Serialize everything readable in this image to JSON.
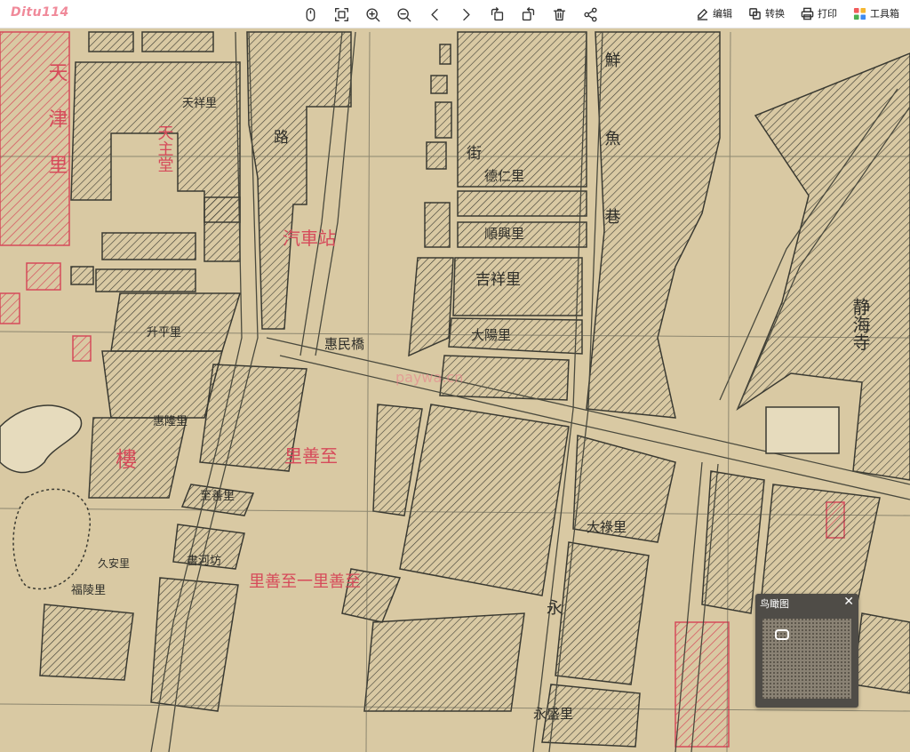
{
  "app": {
    "logo": "Ditu114"
  },
  "toolbar": {
    "tools": [
      {
        "name": "mouse-icon"
      },
      {
        "name": "fit-screen-icon"
      },
      {
        "name": "zoom-in-icon"
      },
      {
        "name": "zoom-out-icon"
      },
      {
        "name": "chevron-left-icon"
      },
      {
        "name": "chevron-right-icon"
      },
      {
        "name": "rotate-left-icon"
      },
      {
        "name": "rotate-right-icon"
      },
      {
        "name": "trash-icon"
      },
      {
        "name": "share-icon"
      }
    ],
    "edit_label": "编辑",
    "convert_label": "转换",
    "print_label": "打印",
    "toolbox_label": "工具箱"
  },
  "map": {
    "watermark": "paywa.cn",
    "labels": {
      "tianzhu": "天主堂",
      "tianxiang": "天祥里",
      "tianjinli": "天津里",
      "lu": "路",
      "qichezhan": "汽車站",
      "huiminqiao": "惠民橋",
      "jie": "街",
      "deren": "德仁里",
      "shunxing": "順興里",
      "jixiang": "吉祥里",
      "dayang": "大陽里",
      "xianyu": "鮮魚巷",
      "jinghai": "静海寺",
      "shengping": "升平里",
      "huilong": "惠隆里",
      "zhishan": "至善里",
      "zhishan2": "里善至",
      "shuhe": "書河坊",
      "dalu": "大祿里",
      "yong": "永",
      "yongsheng": "永盛里",
      "guanglin": "福陵里",
      "jiuyuanli": "久安里",
      "lou": "樓",
      "hongli": "里善至一里善至"
    },
    "colors": {
      "paper": "#d9c9a3",
      "ink": "#3a3a32",
      "red": "#d64a5a"
    }
  },
  "overview": {
    "title": "鸟瞰图",
    "close": "✕"
  }
}
